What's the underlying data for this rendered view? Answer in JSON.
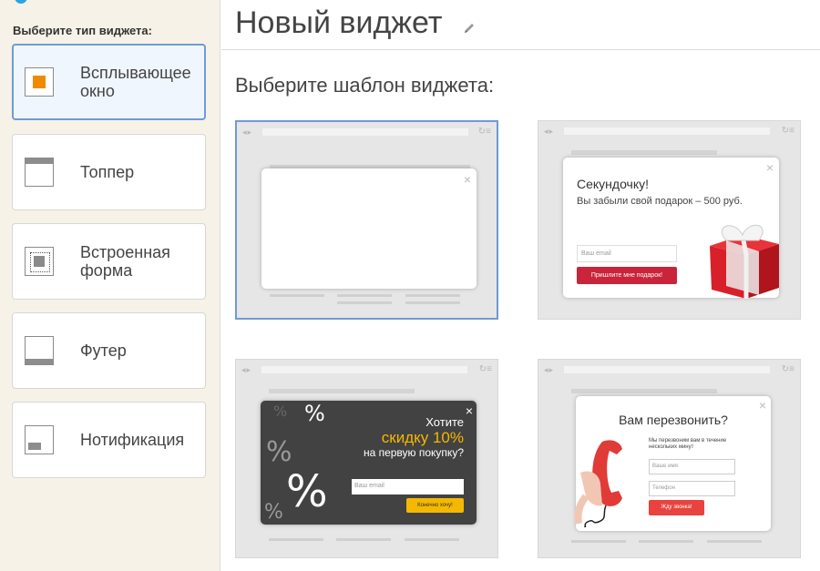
{
  "sidebar": {
    "title": "Выберите тип виджета:",
    "types": [
      {
        "label": "Всплывающее\nокно",
        "selected": true
      },
      {
        "label": "Топпер"
      },
      {
        "label": "Встроенная\nформа"
      },
      {
        "label": "Футер"
      },
      {
        "label": "Нотификация"
      }
    ]
  },
  "main": {
    "title": "Новый виджет",
    "subtitle": "Выберите шаблон виджета:"
  },
  "templates": {
    "t2": {
      "title": "Секундочку!",
      "subtitle": "Вы забыли свой подарок – 500 руб.",
      "input_placeholder": "Ваш email",
      "button": "Пришлите мне подарок!"
    },
    "t3": {
      "line1": "Хотите",
      "line2": "скидку 10%",
      "line3": "на первую покупку?",
      "input_placeholder": "Ваш email",
      "button": "Конечно хочу!"
    },
    "t4": {
      "title": "Вам перезвонить?",
      "description": "Мы перезвоним вам в течение нескольких минут",
      "name_placeholder": "Ваше имя",
      "phone_placeholder": "Телефон",
      "button": "Жду звонка!"
    },
    "close_glyph": "×"
  },
  "colors": {
    "accent_orange": "#f08a00",
    "selection_blue": "#6f9bd4",
    "gift_red": "#c9243a",
    "promo_yellow": "#f5b800",
    "call_red": "#e8433f"
  }
}
